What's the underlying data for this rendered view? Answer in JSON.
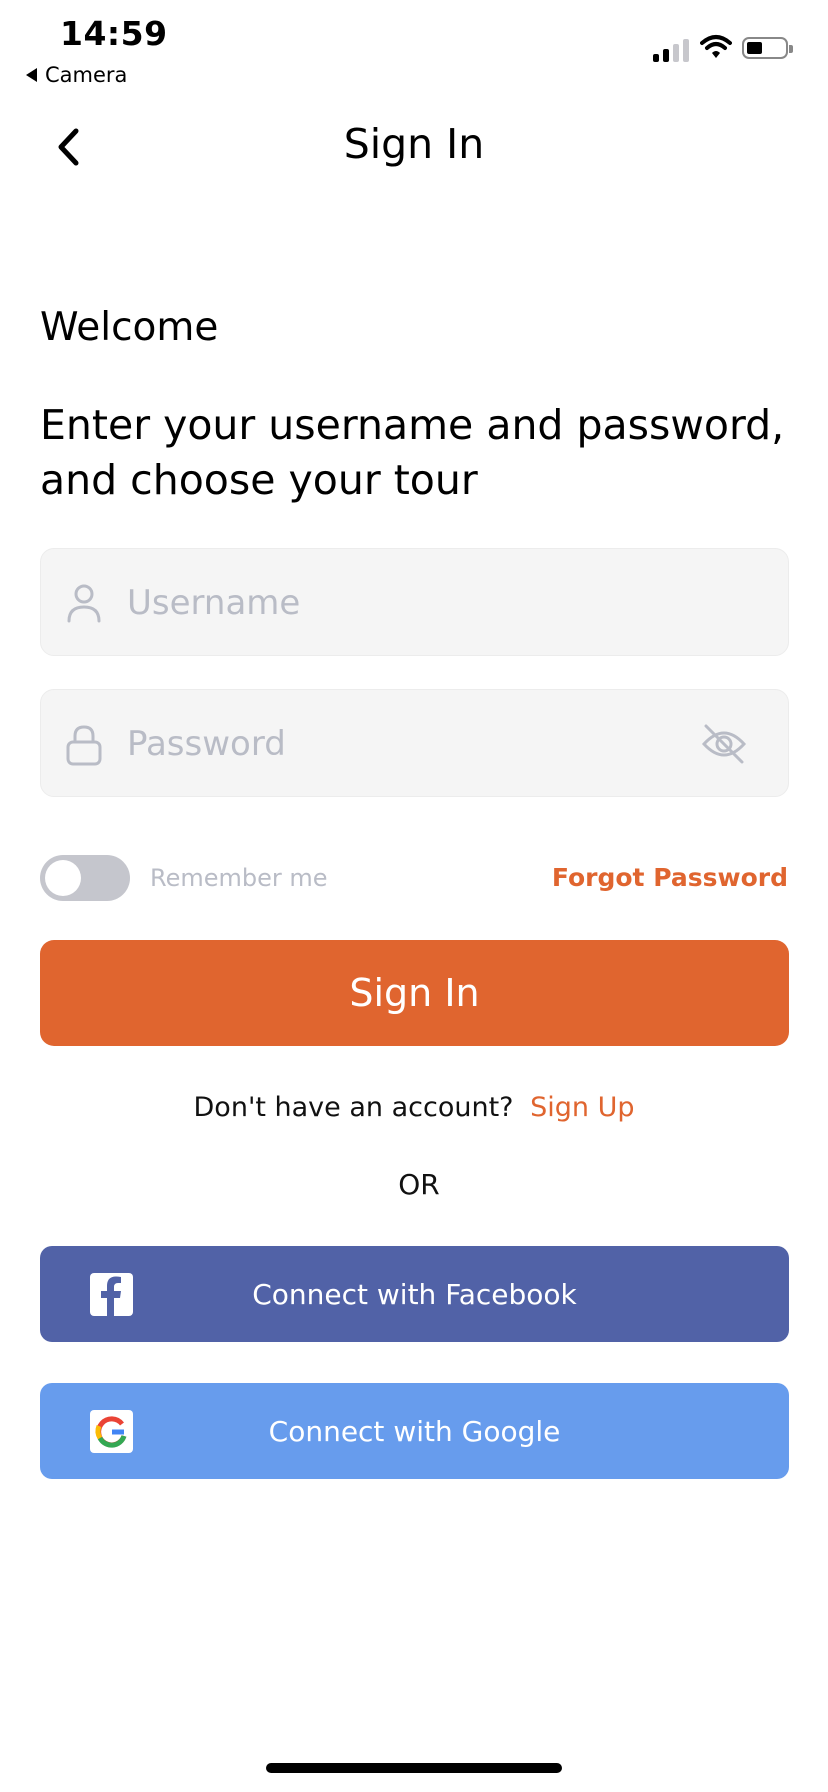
{
  "status_bar": {
    "time": "14:59",
    "back_app_label": "Camera",
    "icons": [
      "signal-icon",
      "wifi-icon",
      "battery-icon"
    ]
  },
  "header": {
    "title": "Sign In",
    "back_icon": "chevron-left-icon"
  },
  "intro": {
    "welcome": "Welcome",
    "instructions": "Enter your username and password, and choose your tour"
  },
  "form": {
    "username": {
      "placeholder": "Username",
      "value": "",
      "icon": "user-icon"
    },
    "password": {
      "placeholder": "Password",
      "value": "",
      "icon": "lock-icon",
      "toggle_icon": "eye-off-icon"
    },
    "remember_label": "Remember me",
    "remember_on": false,
    "forgot_label": "Forgot Password",
    "submit_label": "Sign In"
  },
  "signup": {
    "prompt": "Don't have an account?",
    "link": "Sign Up"
  },
  "divider": "OR",
  "social": {
    "facebook_label": "Connect with Facebook",
    "google_label": "Connect with Google"
  },
  "colors": {
    "accent": "#e0652f",
    "facebook": "#5162a7",
    "google": "#679ced",
    "placeholder": "#b9bcc6",
    "field_bg": "#f5f5f5"
  }
}
